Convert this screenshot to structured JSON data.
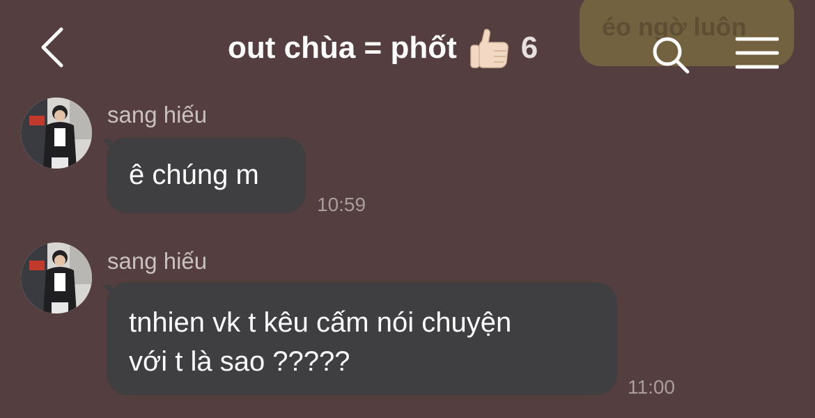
{
  "header": {
    "title": "out chùa = phốt",
    "member_count": "6",
    "background_message_preview": "éo ngờ luôn"
  },
  "messages": [
    {
      "sender": "sang hiếu",
      "lines": [
        "ê chúng m"
      ],
      "time": "10:59"
    },
    {
      "sender": "sang hiếu",
      "lines": [
        "tnhien vk t kêu cấm nói chuyện",
        "với t là sao ?????"
      ],
      "time": "11:00"
    }
  ],
  "colors": {
    "background": "#553e40",
    "bubble": "#3f3e40",
    "text": "#ffffff",
    "secondary_text": "#c9c1c1",
    "timestamp": "#a99d9e"
  },
  "icons": [
    "back-arrow-icon",
    "thumbs-up-icon",
    "search-icon",
    "menu-icon"
  ]
}
